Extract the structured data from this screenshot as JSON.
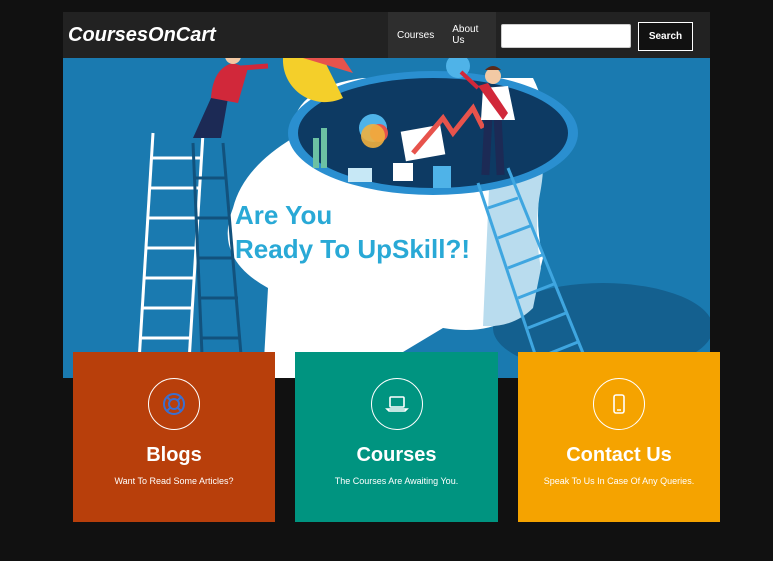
{
  "navbar": {
    "brand": "CoursesOnCart",
    "links": [
      {
        "label": "Courses"
      },
      {
        "label": "About Us"
      }
    ],
    "search": {
      "value": "",
      "placeholder": "",
      "button_label": "Search"
    }
  },
  "hero": {
    "line1": "Are You",
    "line2": "Ready To UpSkill?!"
  },
  "cards": [
    {
      "title": "Blogs",
      "subtitle": "Want To Read Some Articles?",
      "icon": "lifebuoy-icon",
      "color": "#b83f0b"
    },
    {
      "title": "Courses",
      "subtitle": "The Courses Are Awaiting You.",
      "icon": "laptop-icon",
      "color": "#009480"
    },
    {
      "title": "Contact Us",
      "subtitle": "Speak To Us In Case Of Any Queries.",
      "icon": "mobile-phone-icon",
      "color": "#f5a300"
    }
  ],
  "colors": {
    "page_bg": "#111111",
    "navbar_bg": "#222222",
    "hero_bg": "#1a7ab0",
    "hero_text": "#29a9d6"
  }
}
